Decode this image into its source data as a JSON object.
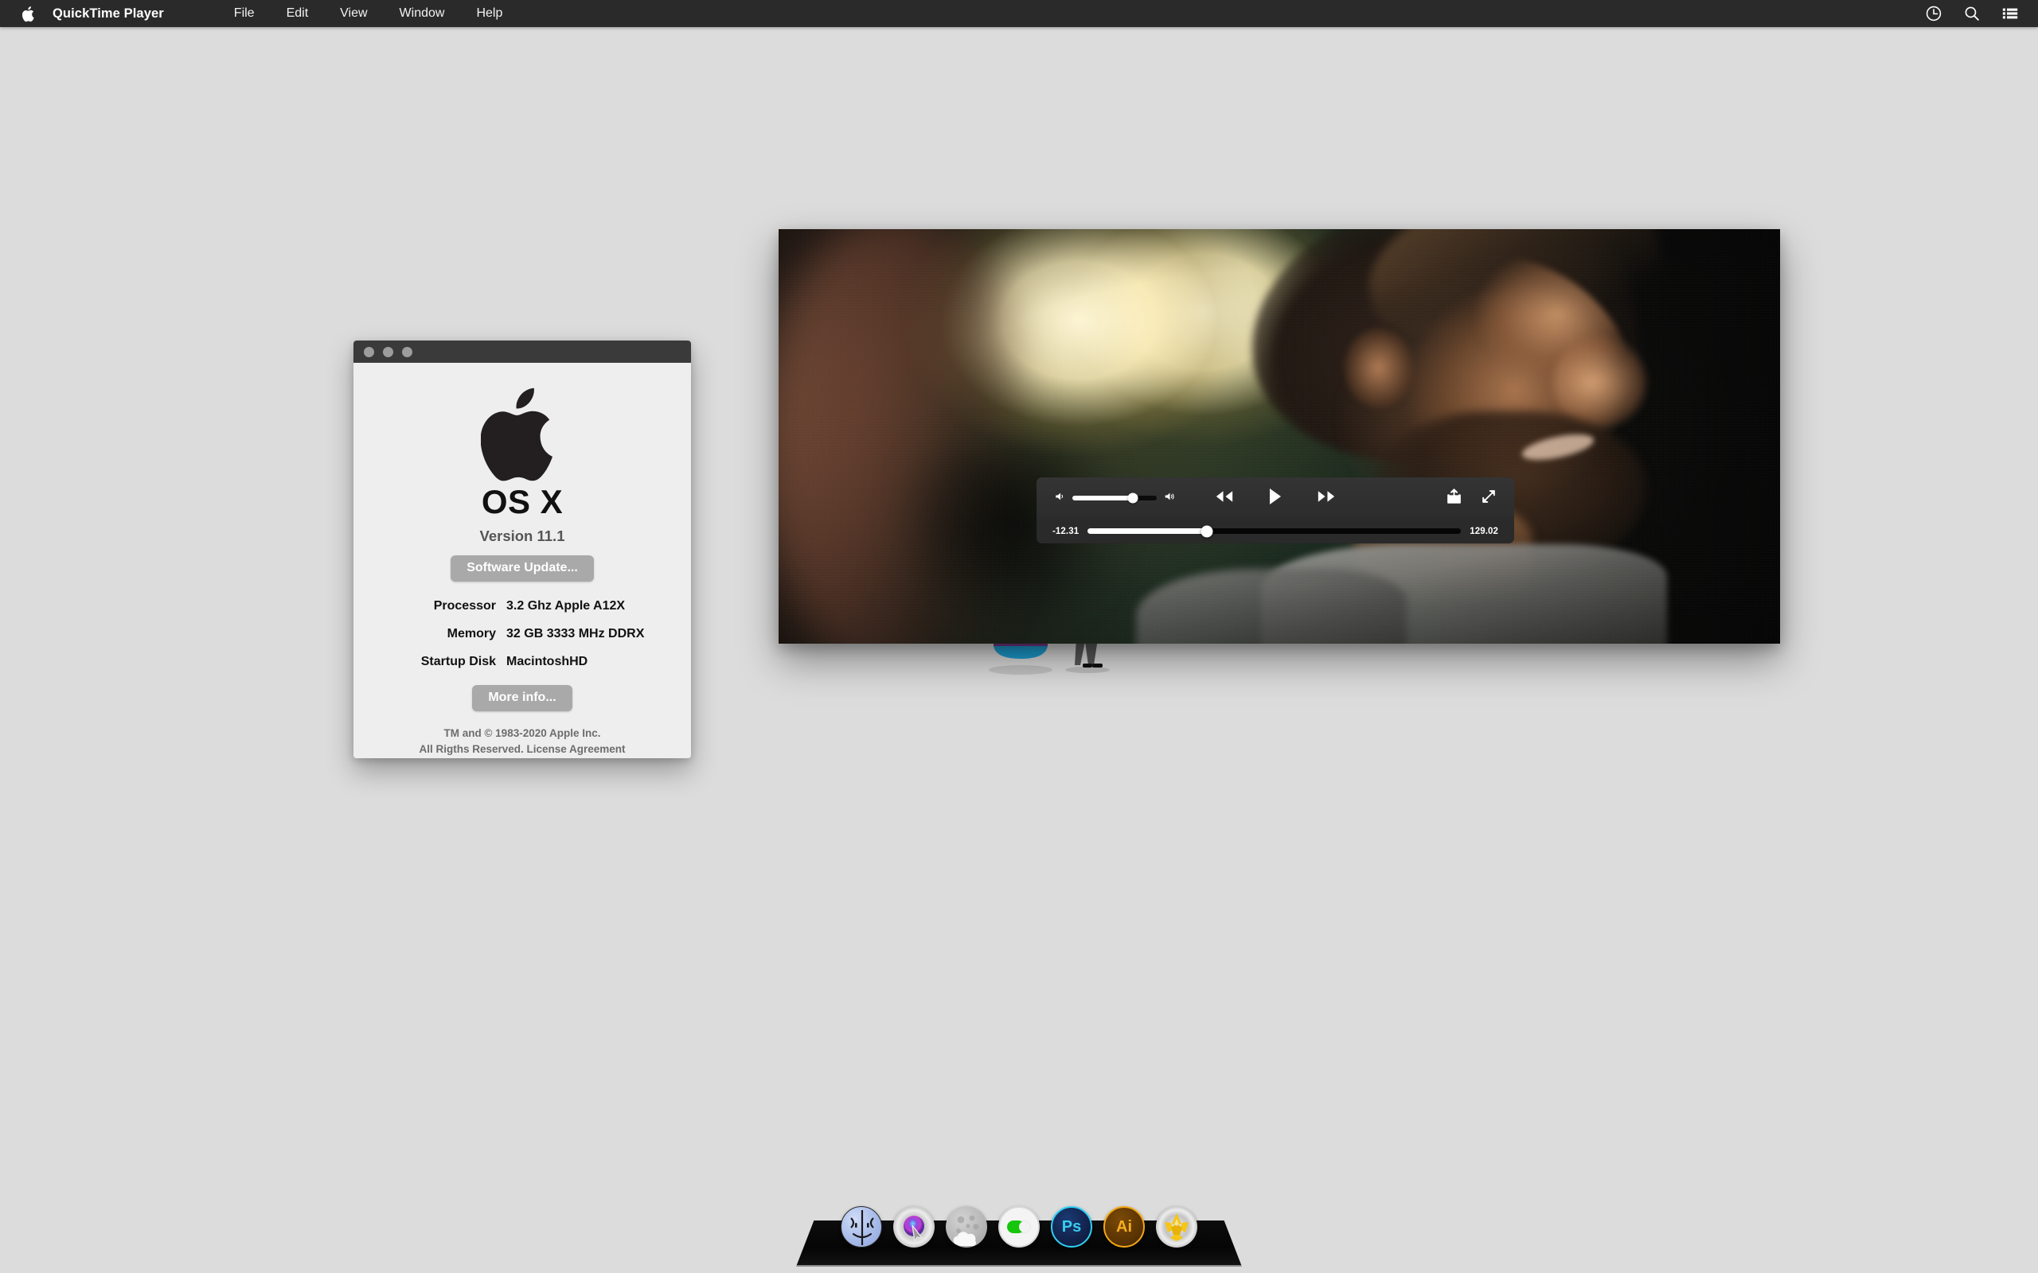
{
  "menubar": {
    "apple_icon": "apple-logo-icon",
    "app_name": "QuickTime Player",
    "items": [
      "File",
      "Edit",
      "View",
      "Window",
      "Help"
    ],
    "right_icons": [
      "clock-icon",
      "search-icon",
      "list-icon"
    ]
  },
  "about_window": {
    "traffic_lights": [
      "close-button",
      "minimize-button",
      "zoom-button"
    ],
    "apple_icon": "apple-logo-icon",
    "os_name": "OS X",
    "version": "Version 11.1",
    "software_update_label": "Software Update...",
    "specs": [
      {
        "label": "Processor",
        "value": "3.2 Ghz Apple A12X"
      },
      {
        "label": "Memory",
        "value": "32 GB 3333 MHz DDRX"
      },
      {
        "label": "Startup Disk",
        "value": "MacintoshHD"
      }
    ],
    "more_info_label": "More info...",
    "legal_line1": "TM and © 1983-2020 Apple Inc.",
    "legal_line2": "All Rigths Reserved. License Agreement"
  },
  "player": {
    "volume_icon_low": "speaker-low-icon",
    "volume_icon_high": "speaker-high-icon",
    "volume_percent": 72,
    "rewind_icon": "rewind-icon",
    "play_icon": "play-icon",
    "forward_icon": "fast-forward-icon",
    "share_icon": "share-icon",
    "fullscreen_icon": "fullscreen-icon",
    "time_elapsed": "-12.31",
    "time_remaining": "129.02",
    "progress_percent": 32
  },
  "dock": {
    "items": [
      {
        "name": "finder",
        "label": ""
      },
      {
        "name": "siri",
        "label": ""
      },
      {
        "name": "weather",
        "label": ""
      },
      {
        "name": "settings",
        "label": ""
      },
      {
        "name": "photoshop",
        "label": "Ps"
      },
      {
        "name": "illustrator",
        "label": "Ai"
      },
      {
        "name": "gold-app",
        "label": ""
      }
    ]
  },
  "colors": {
    "menubar_bg": "#2a2a2a",
    "desktop_bg": "#dcdcdc",
    "window_bg": "#eeeeee",
    "titlebar_bg": "#3a3a3a",
    "button_gray": "#a9a9a9",
    "hud_bg": "#2a2a2a",
    "accent_green": "#16c60c"
  }
}
